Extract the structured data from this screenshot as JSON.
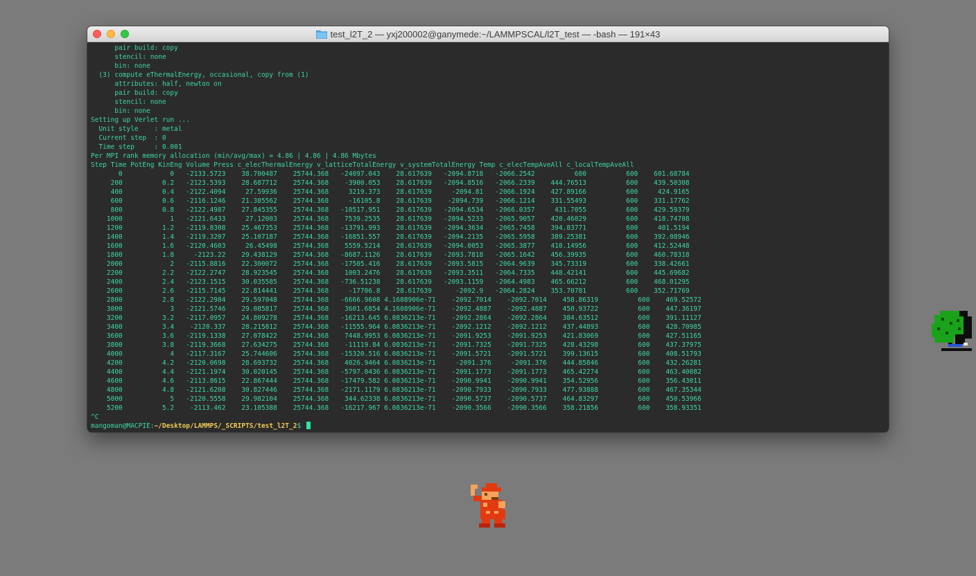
{
  "window": {
    "title": "test_l2T_2 — yxj200002@ganymede:~/LAMMPSCAL/l2T_test — -bash — 191×43"
  },
  "terminal": {
    "lines": [
      "      pair build: copy",
      "      stencil: none",
      "      bin: none",
      "  (3) compute eThermalEnergy, occasional, copy from (1)",
      "      attributes: half, newton on",
      "      pair build: copy",
      "      stencil: none",
      "      bin: none",
      "Setting up Verlet run ...",
      "  Unit style    : metal",
      "  Current step  : 0",
      "  Time step     : 0.001",
      "Per MPI rank memory allocation (min/avg/max) = 4.86 | 4.86 | 4.86 Mbytes",
      "Step Time PotEng KinEng Volume Press c_elecThermalEnergy v_latticeTotalEnergy v_systemTotalEnergy Temp c_elecTempAveAll c_localTempAveAll",
      "       0            0   -2133.5723    38.700487    25744.368   -24097.043    28.617639   -2094.8718   -2066.2542          600          600    601.68784",
      "     200          0.2   -2123.5393    28.687712    25744.368    -3900.053    28.617639   -2094.8516   -2066.2339    444.76513          600    439.50308",
      "     400          0.4   -2122.4094     27.59936    25744.368     3219.373    28.617639     -2094.81   -2066.1924    427.89166          600     424.9165",
      "     600          0.6   -2116.1246    21.385562    25744.368     -16105.8    28.617639    -2094.739   -2066.1214    331.55493          600    331.17762",
      "     800          0.8   -2122.4987    27.845355    25744.368   -10517.951    28.617639   -2094.6534   -2066.0357     431.7055          600    429.59379",
      "    1000            1   -2121.6433     27.12003    25744.368    7539.2535    28.617639   -2094.5233   -2065.9057    420.46029          600    418.74708",
      "    1200          1.2   -2119.8308    25.467353    25744.368   -13791.993    28.617639   -2094.3634   -2065.7458    394.83771          600     401.5194",
      "    1400          1.4   -2119.3207    25.107187    25744.368   -16851.557    28.617639   -2094.2135   -2065.5958    389.25381          600    392.08946",
      "    1600          1.6   -2120.4603     26.45498    25744.368    5559.5214    28.617639   -2094.0053   -2065.3877    410.14956          600    412.52448",
      "    1800          1.8     -2123.22    29.438129    25744.368   -8687.1126    28.617639   -2093.7818   -2065.1642    456.39935          600    460.78318",
      "    2000            2   -2115.8816    22.300072    25744.368   -17505.416    28.617639   -2093.5815   -2064.9639    345.73319          600    338.42661",
      "    2200          2.2   -2122.2747    28.923545    25744.368    1003.2476    28.617639   -2093.3511   -2064.7335    448.42141          600    445.69682",
      "    2400          2.4   -2123.1515    30.035585    25744.368   -736.51238    28.617639   -2093.1159   -2064.4983    465.66212          600    468.01295",
      "    2600          2.6   -2115.7145    22.814441    25744.368     -17706.8    28.617639      -2092.9   -2064.2824    353.70781          600    352.71769",
      "    2800          2.8   -2122.2984    29.597048    25744.368   -6666.9608 4.1608906e-71    -2092.7014    -2092.7014    458.86319          600    469.52572",
      "    3000            3   -2121.5746    29.085817    25744.368    3601.6854 4.1608906e-71    -2092.4887    -2092.4887    450.93722          600    447.36197",
      "    3200          3.2   -2117.0957    24.809278    25744.368   -16213.645 6.0836213e-71    -2092.2864    -2092.2864    384.63512          600    391.11127",
      "    3400          3.4    -2120.337    28.215812    25744.368   -11555.964 6.0836213e-71    -2092.1212    -2092.1212    437.44893          600    428.70985",
      "    3600          3.6   -2119.1338    27.078422    25744.368    7448.9953 6.0836213e-71    -2091.9253    -2091.9253    421.83069          600    427.51165",
      "    3800          3.8   -2119.3668    27.634275    25744.368    -11119.84 6.0836213e-71    -2091.7325    -2091.7325    428.43298          600    437.37975",
      "    4000            4   -2117.3167    25.744606    25744.368   -15320.516 6.0836213e-71    -2091.5721    -2091.5721    399.13615          600    408.51793",
      "    4200          4.2   -2120.0698    28.693732    25744.368    4026.9464 6.0836213e-71     -2091.376     -2091.376    444.85846          600    432.26281",
      "    4400          4.4   -2121.1974    30.020145    25744.368   -5797.0436 6.0836213e-71    -2091.1773    -2091.1773    465.42274          600    463.40082",
      "    4600          4.6   -2113.8615    22.867444    25744.368   -17479.582 6.0836213e-71    -2090.9941    -2090.9941    354.52956          600    356.43011",
      "    4800          4.8   -2121.6208    30.827446    25744.368   -2171.1179 6.0836213e-71    -2090.7933    -2090.7933    477.93888          600    467.35344",
      "    5000            5   -2120.5558    29.982104    25744.368    344.62338 6.0836213e-71    -2090.5737    -2090.5737    464.83297          600    450.53966",
      "    5200          5.2    -2113.462    23.105388    25744.368   -16217.967 6.0836213e-71    -2090.3566    -2090.3566    358.21856          600    358.93351",
      "^C"
    ],
    "prompt": {
      "user_host": "mangoman@MACPIE",
      "separator": ":",
      "path": "~/Desktop/LAMMPS/_SCRIPTS/test_l2T_2",
      "dollar": "$ "
    }
  },
  "colors": {
    "desktop": "#7b7b7b",
    "terminal_bg": "#2b2b2b",
    "terminal_text": "#3fd6a7",
    "prompt_path": "#f2cb55",
    "cursor": "#2ee5a2"
  },
  "icons": {
    "title_folder": "folder-icon",
    "desktop_tree": "tree-sprite-icon",
    "desktop_character": "mario-sprite-icon"
  }
}
